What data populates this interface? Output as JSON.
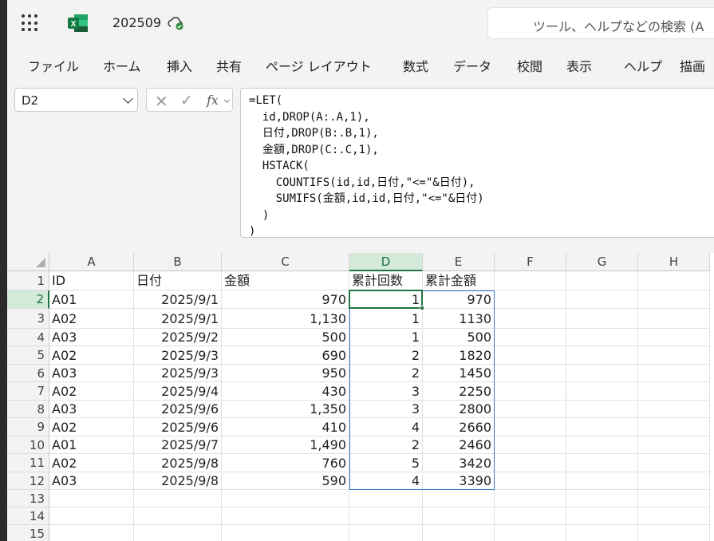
{
  "titlebar": {
    "file_name": "202509",
    "search_placeholder": "ツール、ヘルプなどの検索 (A"
  },
  "ribbon": {
    "tabs": [
      "ファイル",
      "ホーム",
      "挿入",
      "共有",
      "ページ レイアウト",
      "数式",
      "データ",
      "校閲",
      "表示",
      "ヘルプ",
      "描画"
    ]
  },
  "formula_bar": {
    "name_box": "D2",
    "fx_label": "fx",
    "formula": "=LET(\n  id,DROP(A:.A,1),\n  日付,DROP(B:.B,1),\n  金額,DROP(C:.C,1),\n  HSTACK(\n    COUNTIFS(id,id,日付,\"<=\"&日付),\n    SUMIFS(金額,id,id,日付,\"<=\"&日付)\n  )\n)"
  },
  "sheet": {
    "columns": [
      "A",
      "B",
      "C",
      "D",
      "E",
      "F",
      "G",
      "H"
    ],
    "selected_column": "D",
    "selected_row": "2",
    "row_numbers": [
      "1",
      "2",
      "3",
      "4",
      "5",
      "6",
      "7",
      "8",
      "9",
      "10",
      "11",
      "12",
      "13",
      "14",
      "15"
    ],
    "rows": [
      [
        "ID",
        "日付",
        "金額",
        "累計回数",
        "累計金額"
      ],
      [
        "A01",
        "2025/9/1",
        "970",
        "1",
        "970"
      ],
      [
        "A02",
        "2025/9/1",
        "1,130",
        "1",
        "1130"
      ],
      [
        "A03",
        "2025/9/2",
        "500",
        "1",
        "500"
      ],
      [
        "A02",
        "2025/9/3",
        "690",
        "2",
        "1820"
      ],
      [
        "A03",
        "2025/9/3",
        "950",
        "2",
        "1450"
      ],
      [
        "A02",
        "2025/9/4",
        "430",
        "3",
        "2250"
      ],
      [
        "A03",
        "2025/9/6",
        "1,350",
        "3",
        "2800"
      ],
      [
        "A02",
        "2025/9/6",
        "410",
        "4",
        "2660"
      ],
      [
        "A01",
        "2025/9/7",
        "1,490",
        "2",
        "2460"
      ],
      [
        "A02",
        "2025/9/8",
        "760",
        "5",
        "3420"
      ],
      [
        "A03",
        "2025/9/8",
        "590",
        "4",
        "3390"
      ]
    ]
  },
  "colors": {
    "excel_green": "#217346",
    "spill_border": "#3b74c4",
    "selected_header_bg": "#d3eadb"
  }
}
